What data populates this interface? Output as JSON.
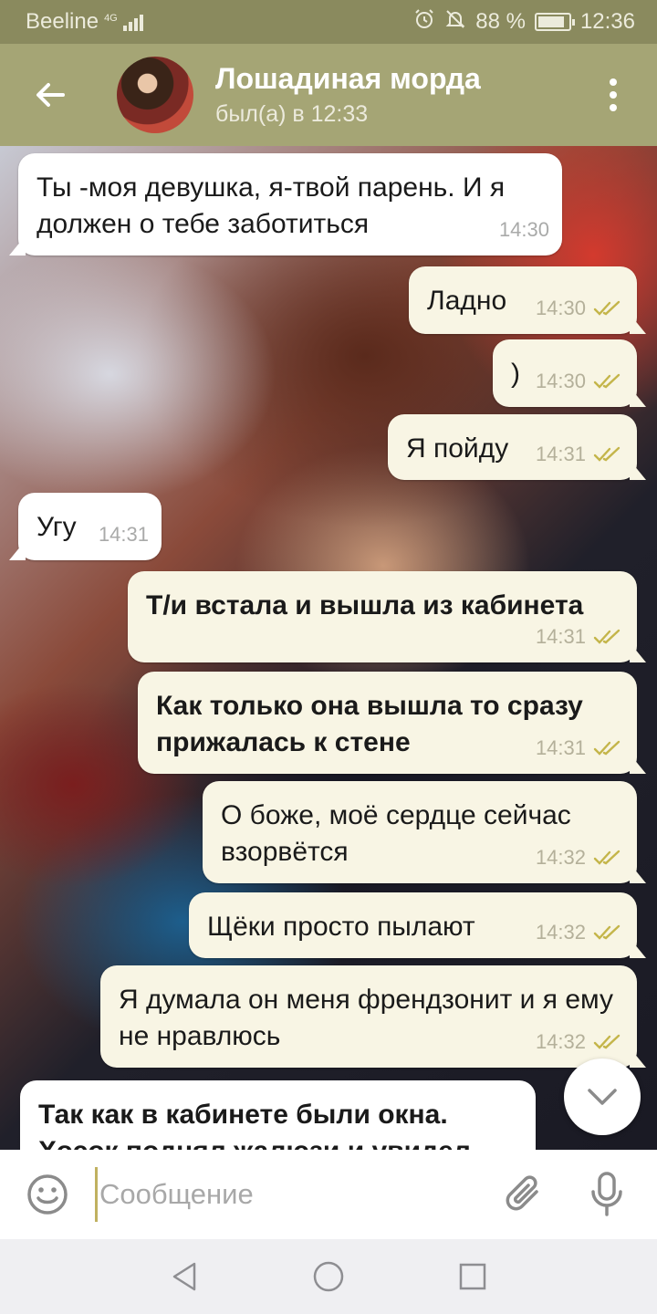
{
  "status_bar": {
    "carrier": "Beeline",
    "network": "4G",
    "battery_percent": "88 %",
    "time": "12:36"
  },
  "header": {
    "name": "Лошадиная морда",
    "status": "был(а) в 12:33"
  },
  "messages": [
    {
      "direction": "in",
      "text": "Ты -моя девушка, я-твой парень. И я должен о тебе заботиться",
      "time": "14:30"
    },
    {
      "direction": "out",
      "text": "Ладно",
      "time": "14:30"
    },
    {
      "direction": "out",
      "text": ")",
      "time": "14:30"
    },
    {
      "direction": "out",
      "text": "Я пойду",
      "time": "14:31"
    },
    {
      "direction": "in",
      "text": "Угу",
      "time": "14:31"
    },
    {
      "direction": "out",
      "text": "Т/и встала и вышла из кабинета",
      "time": "14:31"
    },
    {
      "direction": "out",
      "text": "Как только она вышла то сразу прижалась к стене",
      "time": "14:31"
    },
    {
      "direction": "out",
      "text": "О боже, моё сердце сейчас взорвётся",
      "time": "14:32"
    },
    {
      "direction": "out",
      "text": "Щёки просто пылают",
      "time": "14:32"
    },
    {
      "direction": "out",
      "text": "Я думала он меня френдзонит и я ему не нравлюсь",
      "time": "14:32"
    },
    {
      "direction": "in",
      "text": "Так как в кабинете были окна. Хосок поднял жалюзи и увидел",
      "time": ""
    }
  ],
  "input": {
    "placeholder": "Сообщение",
    "value": ""
  },
  "colors": {
    "header": "#a5a575",
    "status_bar": "#8a8a5e",
    "outgoing_bubble": "#f8f5e4",
    "incoming_bubble": "#ffffff",
    "read_checks": "#c4b54a"
  },
  "icons": {
    "back": "arrow-left-icon",
    "menu": "more-vertical-icon",
    "emoji": "smiley-icon",
    "attach": "paperclip-icon",
    "mic": "microphone-icon",
    "scroll": "chevron-down-icon",
    "nav_back": "triangle-back-icon",
    "nav_home": "circle-home-icon",
    "nav_recents": "square-recents-icon"
  }
}
